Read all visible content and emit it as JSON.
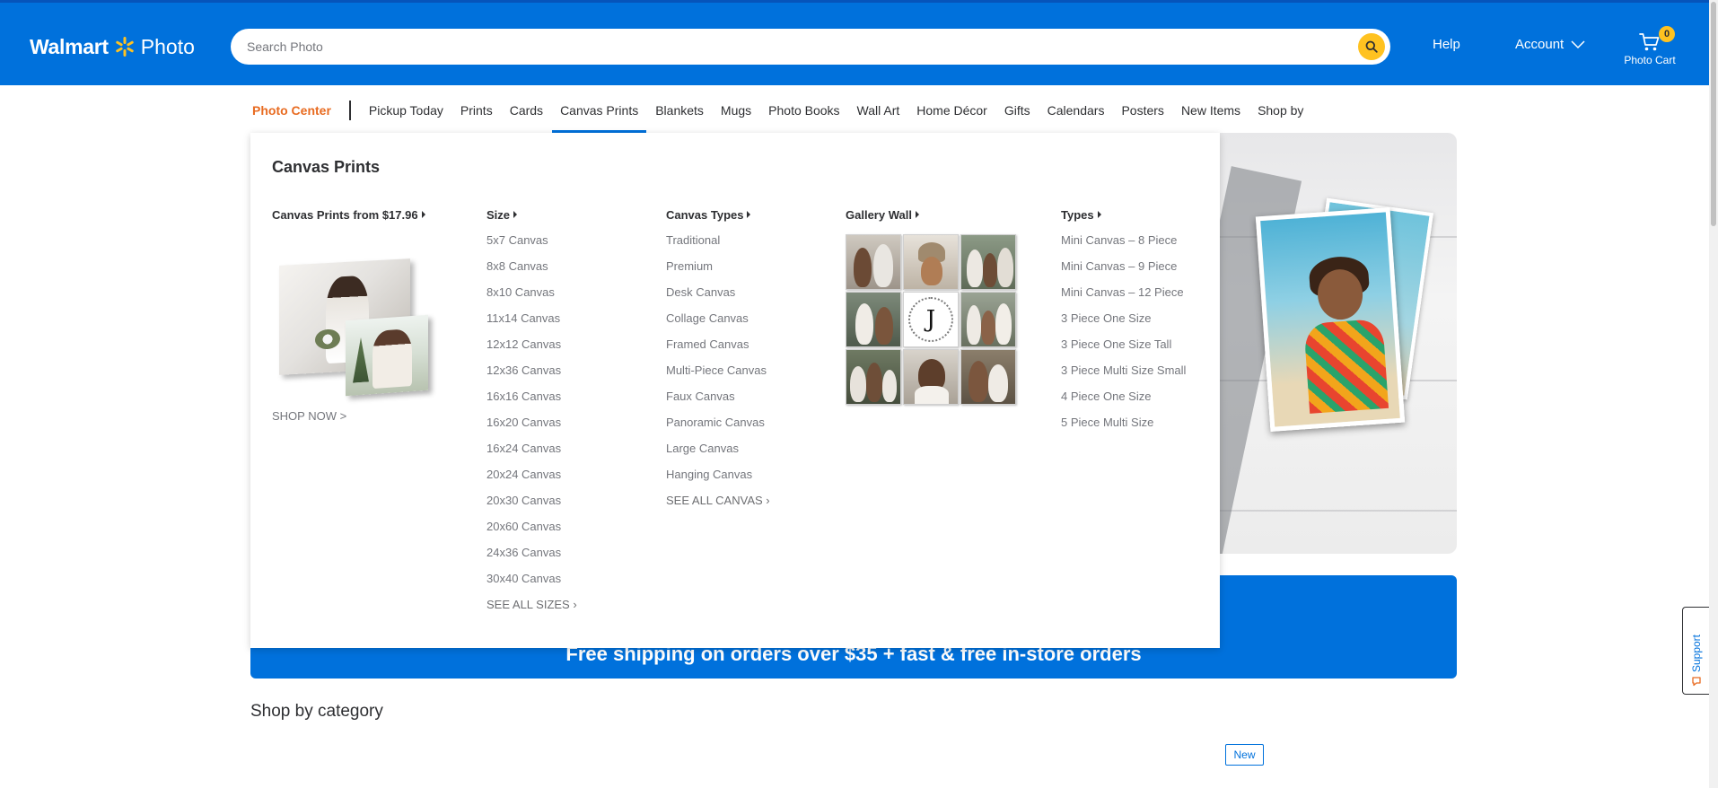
{
  "header": {
    "logo_brand": "Walmart",
    "logo_sub": "Photo",
    "search_placeholder": "Search Photo",
    "help_label": "Help",
    "account_label": "Account",
    "cart_label": "Photo Cart",
    "cart_count": "0",
    "colors": {
      "bar": "#0071dc",
      "spark": "#ffc220",
      "search_button": "#ffc220"
    }
  },
  "nav": {
    "items": [
      "Photo Center",
      "Pickup Today",
      "Prints",
      "Cards",
      "Canvas Prints",
      "Blankets",
      "Mugs",
      "Photo Books",
      "Wall Art",
      "Home Décor",
      "Gifts",
      "Calendars",
      "Posters",
      "New Items",
      "Shop by"
    ],
    "active": "Canvas Prints"
  },
  "mega_menu": {
    "title": "Canvas Prints",
    "feature": {
      "heading": "Canvas Prints from $17.96",
      "cta": "SHOP NOW >"
    },
    "size": {
      "heading": "Size",
      "items": [
        "5x7 Canvas",
        "8x8 Canvas",
        "8x10 Canvas",
        "11x14 Canvas",
        "12x12 Canvas",
        "12x36 Canvas",
        "16x16 Canvas",
        "16x20 Canvas",
        "16x24 Canvas",
        "20x24 Canvas",
        "20x30 Canvas",
        "20x60 Canvas",
        "24x36 Canvas",
        "30x40 Canvas",
        "SEE ALL SIZES ›"
      ]
    },
    "canvas_types": {
      "heading": "Canvas Types",
      "items": [
        "Traditional",
        "Premium",
        "Desk Canvas",
        "Collage Canvas",
        "Framed Canvas",
        "Multi-Piece Canvas",
        "Faux Canvas",
        "Panoramic Canvas",
        "Large Canvas",
        "Hanging Canvas",
        "SEE ALL CANVAS ›"
      ]
    },
    "gallery_wall": {
      "heading": "Gallery Wall",
      "monogram": "J"
    },
    "types": {
      "heading": "Types",
      "items": [
        "Mini Canvas – 8 Piece",
        "Mini Canvas – 9 Piece",
        "Mini Canvas – 12 Piece",
        "3 Piece One Size",
        "3 Piece One Size Tall",
        "3 Piece Multi Size Small",
        "4 Piece One Size",
        "5 Piece Multi Size"
      ]
    }
  },
  "page": {
    "banner_text": "Free shipping on orders over $35 + fast & free in-store orders",
    "shop_by_category": "Shop by category",
    "new_badge": "New",
    "support_label": "Support"
  }
}
